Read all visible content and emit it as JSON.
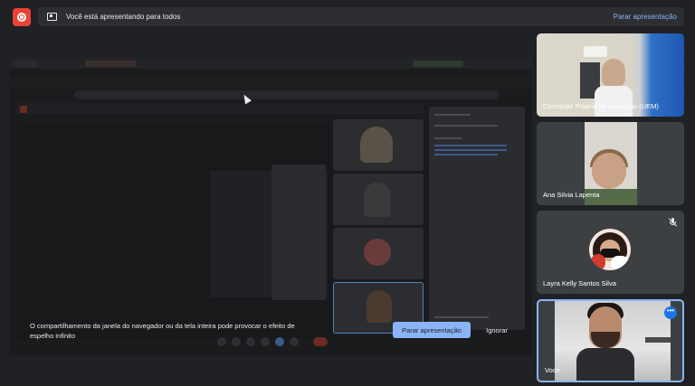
{
  "top_bar": {
    "record_icon": "record-icon",
    "banner_text": "Você está apresentando para todos",
    "banner_button": "Parar apresentação"
  },
  "warning": {
    "message": "O compartilhamento da janela do navegador ou da tela inteira pode provocar o efeito de espelho infinito",
    "stop_button": "Parar apresentação",
    "ignore_button": "Ignorar"
  },
  "participants": [
    {
      "name": "Comissão Própria de Avaliação (UEM)",
      "muted": false
    },
    {
      "name": "Ana Silvia Lapenta",
      "muted": false
    },
    {
      "name": "Layra Kelly Santos Silva",
      "muted": true
    },
    {
      "name": "Você",
      "muted": false,
      "active": true
    }
  ],
  "colors": {
    "accent": "#8ab4f8",
    "record": "#ea4335",
    "background": "#202124"
  }
}
